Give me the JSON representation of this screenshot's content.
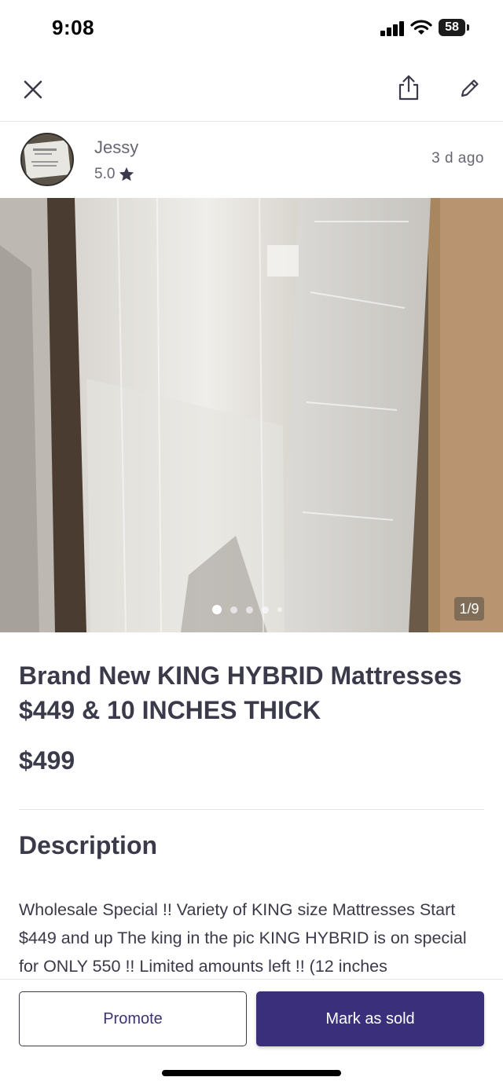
{
  "status_bar": {
    "time": "9:08",
    "battery": "58",
    "icons": [
      "signal-icon",
      "wifi-icon",
      "battery-icon"
    ]
  },
  "nav": {
    "icons": [
      "close-icon",
      "share-icon",
      "edit-icon"
    ]
  },
  "seller": {
    "name": "Jessy",
    "rating": "5.0",
    "rating_icon": "star-icon",
    "posted": "3 d ago"
  },
  "photo": {
    "counter": "1/9",
    "dots_count": 5,
    "active_dot": 1
  },
  "listing": {
    "title": "Brand New KING HYBRID Mattresses $449 & 10 INCHES THICK",
    "price": "$499"
  },
  "description": {
    "heading": "Description",
    "text": "Wholesale Special !! Variety of KING size Mattresses Start $449 and up The king in the pic KING HYBRID is on special for ONLY 550 !! Limited amounts left !! (12 inches"
  },
  "actions": {
    "promote_label": "Promote",
    "mark_sold_label": "Mark as sold"
  },
  "colors": {
    "primary": "#3a2f7a",
    "text": "#3b3a4a",
    "muted": "#666672"
  }
}
